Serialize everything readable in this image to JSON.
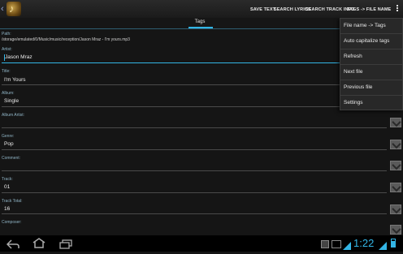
{
  "actionbar": {
    "actions": [
      "SAVE TEXT",
      "SEARCH LYRICS",
      "SEARCH TRACK INFO",
      "TAGS -> FILE NAME"
    ]
  },
  "tabs": [
    {
      "label": "Tags",
      "selected": true
    }
  ],
  "form": {
    "path_label": "Path:",
    "path_value": "/storage/emulated/0/Music/music/reception/Jason Mraz - I'm yours.mp3",
    "artist_label": "Artist:",
    "artist_value": "Jason Mraz",
    "title_label": "Title:",
    "title_value": "I'm Yours",
    "album_label": "Album:",
    "album_value": "Single",
    "album_artist_label": "Album Artist:",
    "album_artist_value": "",
    "genre_label": "Genre:",
    "genre_value": "Pop",
    "comment_label": "Comment:",
    "comment_value": "",
    "track_label": "Track:",
    "track_value": "01",
    "track_total_label": "Track Total:",
    "track_total_value": "16",
    "composer_label": "Composer:",
    "composer_value": ""
  },
  "menu": {
    "items": [
      "File name -> Tags",
      "Auto capitalize tags",
      "Refresh",
      "Next file",
      "Previous file",
      "Settings"
    ]
  },
  "system": {
    "time": "1:22"
  },
  "colors": {
    "accent": "#33b5e5",
    "background": "#151515",
    "label": "#8fb3c4"
  }
}
